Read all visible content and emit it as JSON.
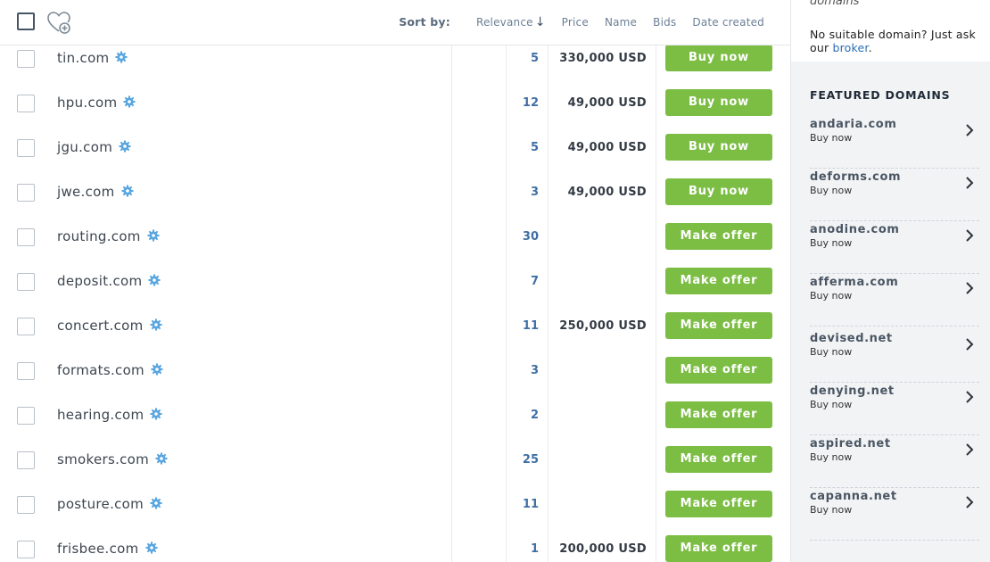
{
  "toolbar": {
    "sort_label": "Sort by:",
    "sort_options": [
      "Relevance",
      "Price",
      "Name",
      "Bids",
      "Date created"
    ],
    "active_sort": "Relevance",
    "sort_arrow": "↓"
  },
  "domains": [
    {
      "name": "tin.com",
      "bids": "5",
      "price": "330,000 USD",
      "action": "Buy now"
    },
    {
      "name": "hpu.com",
      "bids": "12",
      "price": "49,000 USD",
      "action": "Buy now"
    },
    {
      "name": "jgu.com",
      "bids": "5",
      "price": "49,000 USD",
      "action": "Buy now"
    },
    {
      "name": "jwe.com",
      "bids": "3",
      "price": "49,000 USD",
      "action": "Buy now"
    },
    {
      "name": "routing.com",
      "bids": "30",
      "price": "",
      "action": "Make offer"
    },
    {
      "name": "deposit.com",
      "bids": "7",
      "price": "",
      "action": "Make offer"
    },
    {
      "name": "concert.com",
      "bids": "11",
      "price": "250,000 USD",
      "action": "Make offer"
    },
    {
      "name": "formats.com",
      "bids": "3",
      "price": "",
      "action": "Make offer"
    },
    {
      "name": "hearing.com",
      "bids": "2",
      "price": "",
      "action": "Make offer"
    },
    {
      "name": "smokers.com",
      "bids": "25",
      "price": "",
      "action": "Make offer"
    },
    {
      "name": "posture.com",
      "bids": "11",
      "price": "",
      "action": "Make offer"
    },
    {
      "name": "frisbee.com",
      "bids": "1",
      "price": "200,000 USD",
      "action": "Make offer"
    }
  ],
  "sidebar": {
    "top_fragment": "domains",
    "broker_prefix": "No suitable domain? Just ask our ",
    "broker_link": "broker",
    "broker_suffix": ".",
    "featured_title": "FEATURED DOMAINS",
    "featured": [
      {
        "name": "andaria.com",
        "sub": "Buy now"
      },
      {
        "name": "deforms.com",
        "sub": "Buy now"
      },
      {
        "name": "anodine.com",
        "sub": "Buy now"
      },
      {
        "name": "afferma.com",
        "sub": "Buy now"
      },
      {
        "name": "devised.net",
        "sub": "Buy now"
      },
      {
        "name": "denying.net",
        "sub": "Buy now"
      },
      {
        "name": "aspired.net",
        "sub": "Buy now"
      },
      {
        "name": "capanna.net",
        "sub": "Buy now"
      }
    ]
  },
  "colors": {
    "button_green": "#7cbd44",
    "bids_blue": "#3f6fa4",
    "gear_blue": "#5aa6e0",
    "link_blue": "#2a6fb5"
  },
  "icons": {
    "select_all": "checkbox-icon",
    "favorite": "heart-plus-icon",
    "domain_badge": "gear-icon",
    "featured_arrow": "chevron-right-icon"
  }
}
